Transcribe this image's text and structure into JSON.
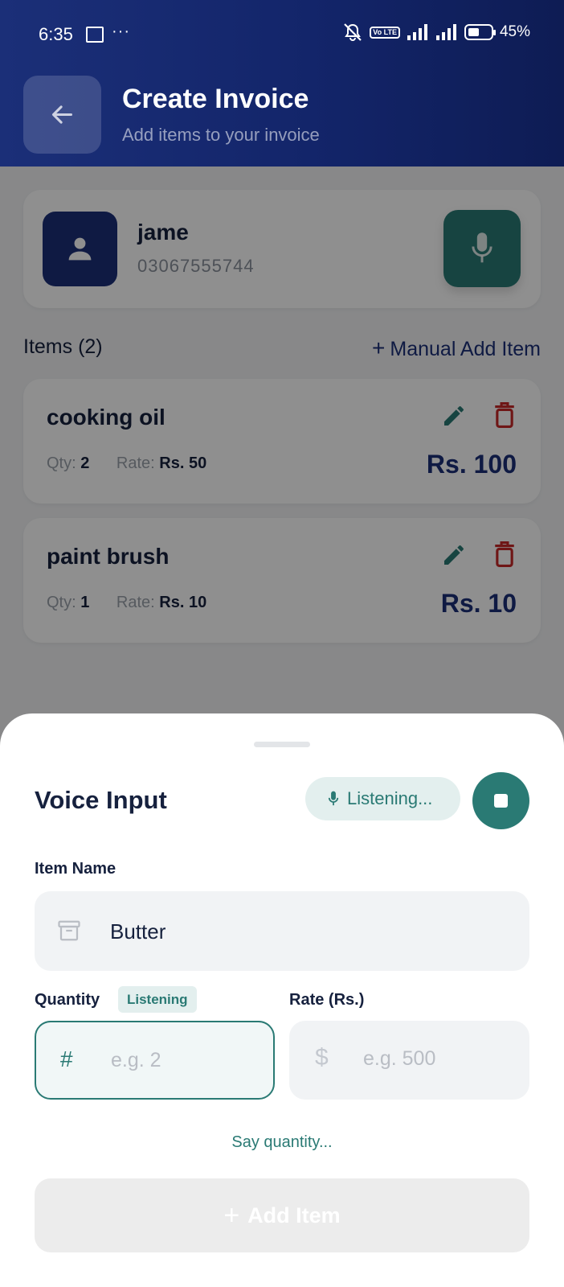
{
  "status_bar": {
    "time": "6:35",
    "more": "···",
    "volte": "Vo LTE",
    "battery": "45%"
  },
  "header": {
    "title": "Create Invoice",
    "subtitle": "Add items to your invoice"
  },
  "customer": {
    "name": "jame",
    "phone": "03067555744"
  },
  "items_section": {
    "title": "Items (2)",
    "manual_add": "Manual Add Item",
    "manual_add_icon": "+"
  },
  "items": [
    {
      "name": "cooking oil",
      "qty_label": "Qty:",
      "qty": "2",
      "rate_label": "Rate:",
      "rate": "Rs. 50",
      "total": "Rs. 100"
    },
    {
      "name": "paint brush",
      "qty_label": "Qty:",
      "qty": "1",
      "rate_label": "Rate:",
      "rate": "Rs. 10",
      "total": "Rs. 10"
    }
  ],
  "sheet": {
    "title": "Voice Input",
    "status": "Listening...",
    "item_name_label": "Item Name",
    "item_name_value": "Butter",
    "quantity_label": "Quantity",
    "quantity_badge": "Listening",
    "quantity_icon": "#",
    "quantity_placeholder": "e.g. 2",
    "rate_label": "Rate (Rs.)",
    "rate_icon": "$",
    "rate_placeholder": "e.g. 500",
    "hint": "Say quantity...",
    "add_button": "Add Item",
    "add_button_icon": "+"
  },
  "colors": {
    "primary": "#1b2f78",
    "accent": "#2a7a74",
    "danger": "#c62828",
    "text": "#16213e"
  }
}
